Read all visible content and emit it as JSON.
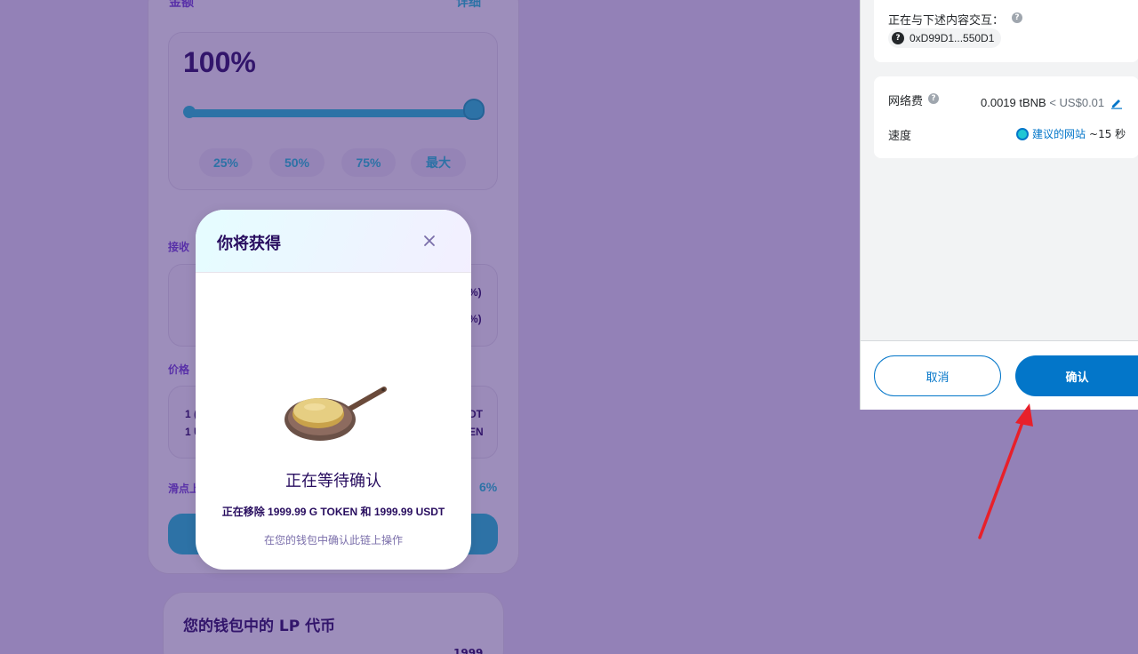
{
  "background": {
    "top_label": "金额",
    "top_link": "详细",
    "percent": "100%",
    "pct_buttons": [
      "25%",
      "50%",
      "75%",
      "最大"
    ],
    "receive_label": "接收",
    "receive_fragments": [
      "%)",
      "%)"
    ],
    "price_label": "价格",
    "price_left_fragments": [
      "1 (",
      "1 U"
    ],
    "price_right_fragments": [
      "DT",
      "EN"
    ],
    "slippage_label": "滑点上",
    "slippage_value": "6%",
    "lp_title": "您的钱包中的 LP 代币",
    "lp_amount": "1999"
  },
  "modal": {
    "title": "你将获得",
    "status": "正在等待确认",
    "detail": "正在移除 1999.99 G TOKEN 和 1999.99 USDT",
    "hint": "在您的钱包中确认此链上操作"
  },
  "wallet": {
    "interact_label": "正在与下述内容交互：",
    "address": "0xD99D1...550D1",
    "fee_label": "网络费",
    "fee_amount": "0.0019 tBNB",
    "fee_usd": "< US$0.01",
    "speed_label": "速度",
    "speed_link": "建议的网站",
    "speed_time": " ~15 秒",
    "cancel_label": "取消",
    "confirm_label": "确认"
  },
  "colors": {
    "accent": "#1fc7d4",
    "wallet_primary": "#0376c9",
    "text_primary": "#280d5f",
    "arrow": "#e8202a"
  }
}
